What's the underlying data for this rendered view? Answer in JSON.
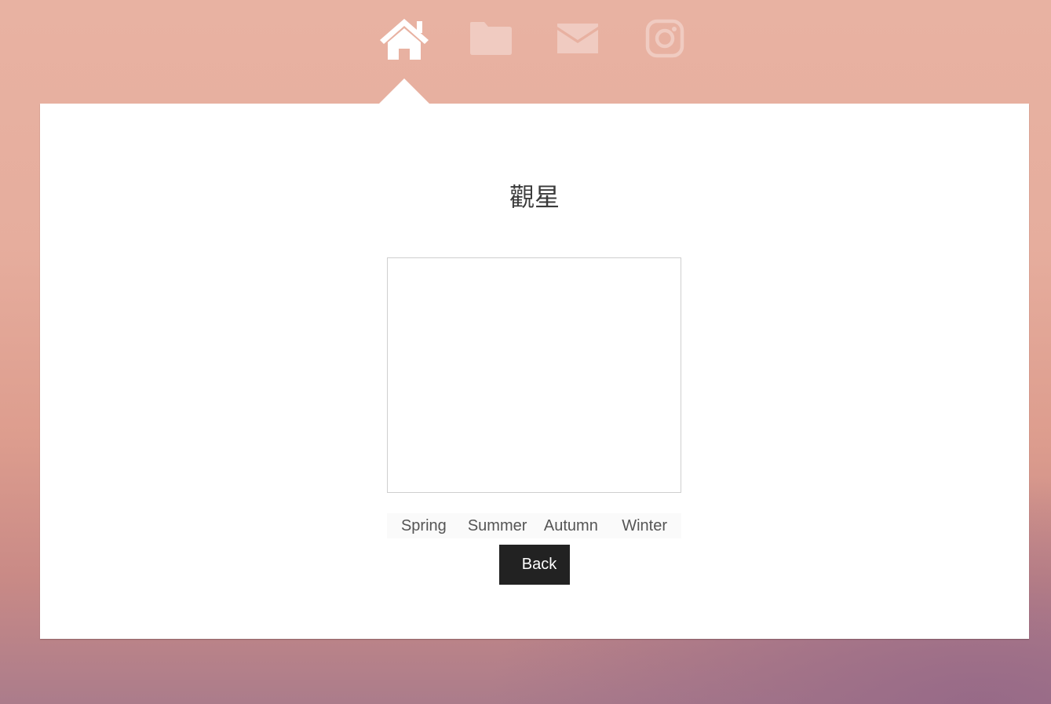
{
  "nav": {
    "items": [
      {
        "icon": "home-icon",
        "active": true
      },
      {
        "icon": "folder-icon",
        "active": false
      },
      {
        "icon": "mail-icon",
        "active": false
      },
      {
        "icon": "instagram-icon",
        "active": false
      }
    ]
  },
  "panel": {
    "title": "觀星",
    "tabs": [
      "Spring",
      "Summer",
      "Autumn",
      "Winter"
    ],
    "back_label": "Back"
  },
  "colors": {
    "active_icon": "#ffffff",
    "inactive_icon": "#f0cbc1",
    "button_bg": "#222222"
  }
}
